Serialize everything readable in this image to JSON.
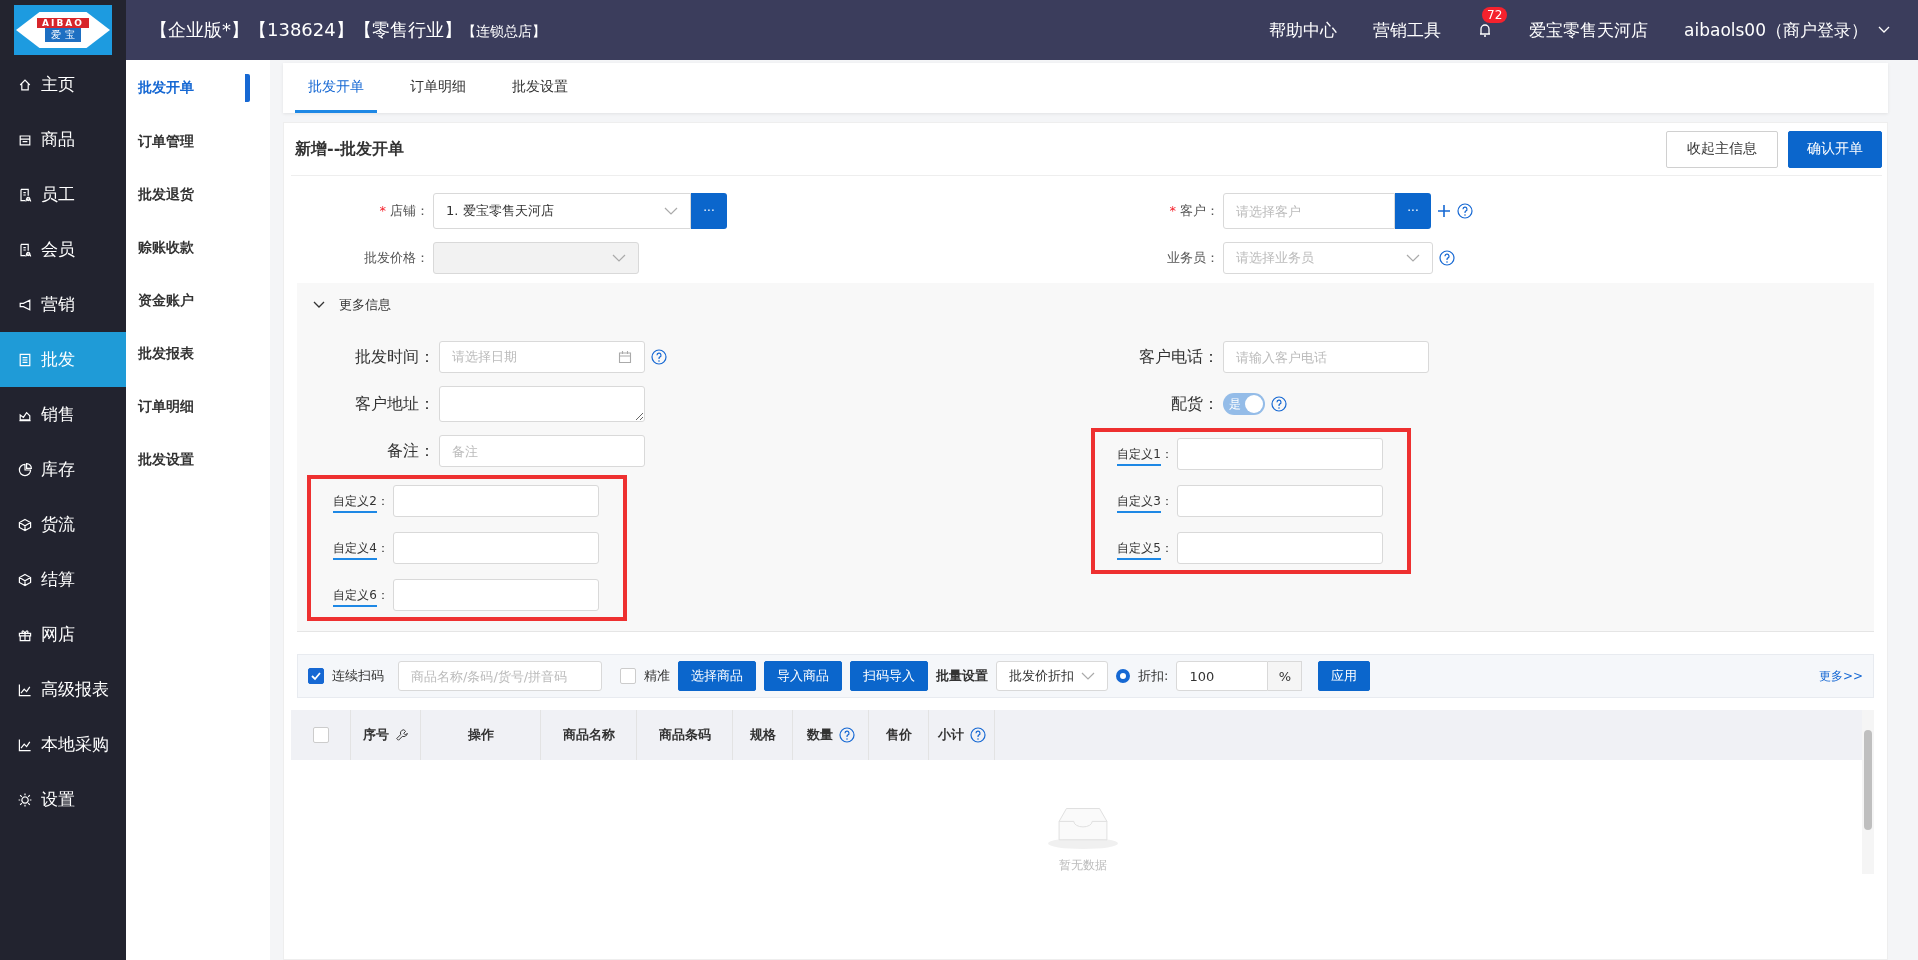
{
  "logo": {
    "text": "AIBAO",
    "subtext": "爱 宝"
  },
  "header": {
    "title": "【企业版*】【138624】【零售行业】",
    "subtitle": "【连锁总店】",
    "links": [
      "帮助中心",
      "营销工具"
    ],
    "badge": "72",
    "store": "爱宝零售天河店",
    "user": "aibaols00（商户登录）"
  },
  "sidebar": {
    "items": [
      {
        "label": "主页",
        "selected": false
      },
      {
        "label": "商品",
        "selected": false
      },
      {
        "label": "员工",
        "selected": false
      },
      {
        "label": "会员",
        "selected": false
      },
      {
        "label": "营销",
        "selected": false
      },
      {
        "label": "批发",
        "selected": true
      },
      {
        "label": "销售",
        "selected": false
      },
      {
        "label": "库存",
        "selected": false
      },
      {
        "label": "货流",
        "selected": false
      },
      {
        "label": "结算",
        "selected": false
      },
      {
        "label": "网店",
        "selected": false
      },
      {
        "label": "高级报表",
        "selected": false
      },
      {
        "label": "本地采购",
        "selected": false
      },
      {
        "label": "设置",
        "selected": false
      }
    ]
  },
  "subnav": {
    "items": [
      {
        "label": "批发开单",
        "selected": true
      },
      {
        "label": "订单管理",
        "selected": false
      },
      {
        "label": "批发退货",
        "selected": false
      },
      {
        "label": "赊账收款",
        "selected": false
      },
      {
        "label": "资金账户",
        "selected": false
      },
      {
        "label": "批发报表",
        "selected": false
      },
      {
        "label": "订单明细",
        "selected": false
      },
      {
        "label": "批发设置",
        "selected": false
      }
    ]
  },
  "tabs": [
    {
      "label": "批发开单",
      "selected": true
    },
    {
      "label": "订单明细",
      "selected": false
    },
    {
      "label": "批发设置",
      "selected": false
    }
  ],
  "form": {
    "title": "新增--批发开单",
    "buttons": [
      {
        "label": "收起主信息",
        "kind": "plain"
      },
      {
        "label": "确认开单",
        "kind": "primary"
      }
    ],
    "left": [
      {
        "kind": "select",
        "required_mark": "*",
        "label": "店铺：",
        "value": "1. 爱宝零售天河店",
        "picker": "···"
      },
      {
        "kind": "select",
        "label": "批发价格：",
        "disabled": true
      }
    ],
    "right": [
      {
        "kind": "input",
        "required_mark": "*",
        "label": "客户：",
        "placeholder": "请选择客户",
        "picker": "···",
        "add": true,
        "help": true
      },
      {
        "kind": "select",
        "label": "业务员：",
        "placeholder": "请选择业务员",
        "help": true
      }
    ]
  },
  "more_info": {
    "title": "更多信息",
    "expanded": true,
    "left": [
      {
        "kind": "date",
        "label": "批发时间：",
        "placeholder": "请选择日期",
        "help": true
      },
      {
        "kind": "textarea",
        "label": "客户地址："
      },
      {
        "kind": "input",
        "label": "备注：",
        "placeholder": "备注"
      },
      {
        "kind": "custom",
        "highlighted": true,
        "fields": [
          {
            "label": "自定义2",
            "separator": "："
          },
          {
            "label": "自定义4",
            "separator": "："
          },
          {
            "label": "自定义6",
            "separator": "："
          }
        ]
      }
    ],
    "right": [
      {
        "kind": "input",
        "label": "客户电话：",
        "placeholder": "请输入客户电话"
      },
      {
        "kind": "switch",
        "label": "配货：",
        "on": true,
        "text": "是",
        "help": true
      },
      {
        "kind": "custom",
        "highlighted": true,
        "fields": [
          {
            "label": "自定义1",
            "separator": "："
          },
          {
            "label": "自定义3",
            "separator": "："
          },
          {
            "label": "自定义5",
            "separator": "："
          }
        ]
      }
    ]
  },
  "toolbar": {
    "scan": {
      "label": "连续扫码",
      "checked": true
    },
    "search": {
      "placeholder": "商品名称/条码/货号/拼音码"
    },
    "exact": {
      "label": "精准",
      "checked": false
    },
    "buttons": [
      "选择商品",
      "导入商品",
      "扫码导入"
    ],
    "batch_label": "批量设置",
    "batch_select": "批发价折扣",
    "discount": {
      "label": "折扣:",
      "selected": true,
      "value": "100",
      "suffix": "%"
    },
    "apply": "应用",
    "more": "更多>>"
  },
  "table": {
    "select_all": false,
    "columns": [
      {
        "label": "序号"
      },
      {
        "label": "操作"
      },
      {
        "label": "商品名称"
      },
      {
        "label": "商品条码"
      },
      {
        "label": "规格"
      },
      {
        "label": "数量",
        "help": true
      },
      {
        "label": "售价"
      },
      {
        "label": "小计",
        "help": true
      }
    ],
    "empty": "暂无数据"
  }
}
